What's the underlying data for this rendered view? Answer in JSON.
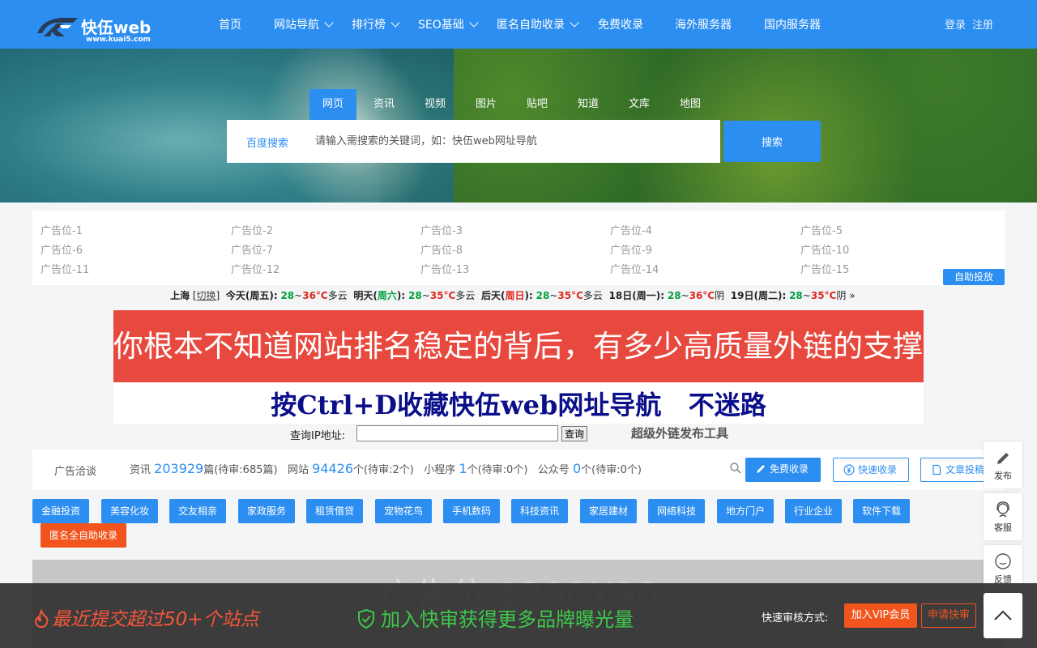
{
  "header": {
    "logo_text": "快伍web",
    "logo_url": "www.kuai5.com",
    "nav": [
      {
        "label": "首页",
        "dropdown": false
      },
      {
        "label": "网站导航",
        "dropdown": true
      },
      {
        "label": "排行榜",
        "dropdown": true
      },
      {
        "label": "SEO基础",
        "dropdown": true
      },
      {
        "label": "匿名自助收录",
        "dropdown": true
      },
      {
        "label": "免费收录",
        "dropdown": false
      },
      {
        "label": "海外服务器",
        "dropdown": false
      },
      {
        "label": "国内服务器",
        "dropdown": false
      }
    ],
    "login": "登录",
    "register": "注册"
  },
  "search": {
    "tabs": [
      "网页",
      "资讯",
      "视频",
      "图片",
      "贴吧",
      "知道",
      "文库",
      "地图"
    ],
    "active_tab": "网页",
    "engine": "百度搜索",
    "placeholder": "请输入需搜索的关键词，如：快伍web网址导航",
    "button": "搜索"
  },
  "ads": {
    "slots": [
      "广告位-1",
      "广告位-2",
      "广告位-3",
      "广告位-4",
      "广告位-5",
      "广告位-6",
      "广告位-7",
      "广告位-8",
      "广告位-9",
      "广告位-10",
      "广告位-11",
      "广告位-12",
      "广告位-13",
      "广告位-14",
      "广告位-15"
    ],
    "self_service": "自助投放"
  },
  "weather": {
    "city": "上海",
    "switch": "切换",
    "days": [
      {
        "label": "今天(周五):",
        "low": "28",
        "high": "36°C",
        "cond": "多云",
        "weekend": ""
      },
      {
        "label": "明天(",
        "weekend": "周六",
        "label_end": "):",
        "low": "28",
        "high": "35°C",
        "cond": "多云"
      },
      {
        "label": "后天(",
        "weekend": "周日",
        "label_end": "):",
        "low": "28",
        "high": "35°C",
        "cond": "多云"
      },
      {
        "label": "18日(周一):",
        "low": "28",
        "high": "36°C",
        "cond": "阴",
        "weekend": ""
      },
      {
        "label": "19日(周二):",
        "low": "28",
        "high": "35°C",
        "cond": "阴",
        "weekend": ""
      }
    ]
  },
  "promo": {
    "red": "你根本不知道网站排名稳定的背后，有多少高质量外链的支撑！",
    "white": "按Ctrl+D收藏快伍web网址导航   不迷路"
  },
  "ip_query": {
    "label": "查询IP地址:",
    "button": "查询",
    "tool": "超级外链发布工具"
  },
  "stats": {
    "label": "广告洽谈",
    "items": [
      {
        "name": "资讯",
        "count": "203929",
        "unit": "篇(待审:685篇)"
      },
      {
        "name": "网站",
        "count": "94426",
        "unit": "个(待审:2个)"
      },
      {
        "name": "小程序",
        "count": "1",
        "unit": "个(待审:0个)"
      },
      {
        "name": "公众号",
        "count": "0",
        "unit": "个(待审:0个)"
      }
    ],
    "buttons": [
      "免费收录",
      "快速收录",
      "文章投稿"
    ]
  },
  "categories": [
    "金融投资",
    "美容化妆",
    "交友相亲",
    "家政服务",
    "租赁借贷",
    "宠物花鸟",
    "手机数码",
    "科技资讯",
    "家居建材",
    "网络科技",
    "地方门户",
    "行业企业",
    "软件下载"
  ],
  "anonymous": "匿名全自助收录",
  "gray_ad": "广告位 1200X90",
  "float": [
    "发布",
    "客服",
    "反馈"
  ],
  "bottom": {
    "left": "最近提交超过50+个站点",
    "center": "加入快审获得更多品牌曝光量",
    "way": "快速审核方式:",
    "vip": "加入VIP会员",
    "fast": "申请快审"
  },
  "colors": {
    "primary": "#2c8ef0",
    "orange": "#f2541d",
    "red_banner": "#e8493f",
    "green": "#3ec84a"
  }
}
